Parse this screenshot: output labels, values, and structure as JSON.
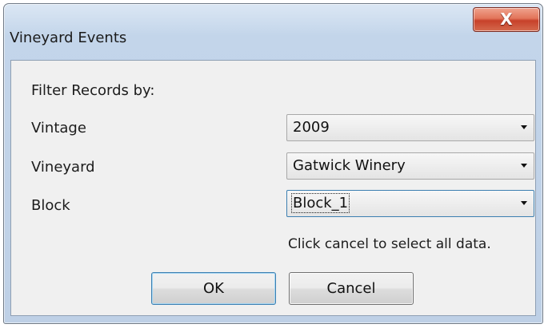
{
  "window": {
    "title": "Vineyard Events",
    "close_icon": "close-icon",
    "close_glyph": "X"
  },
  "form": {
    "heading": "Filter Records by:",
    "fields": [
      {
        "label": "Vintage",
        "value": "2009"
      },
      {
        "label": "Vineyard",
        "value": "Gatwick Winery"
      },
      {
        "label": "Block",
        "value": "Block_1"
      }
    ],
    "hint": "Click cancel to select all data."
  },
  "buttons": {
    "ok_label": "OK",
    "cancel_label": "Cancel"
  },
  "colors": {
    "title_bar": "#c3d5ea",
    "close_button": "#c7412a",
    "client_bg": "#f0f0f0",
    "focus_border": "#3c7fb1"
  }
}
